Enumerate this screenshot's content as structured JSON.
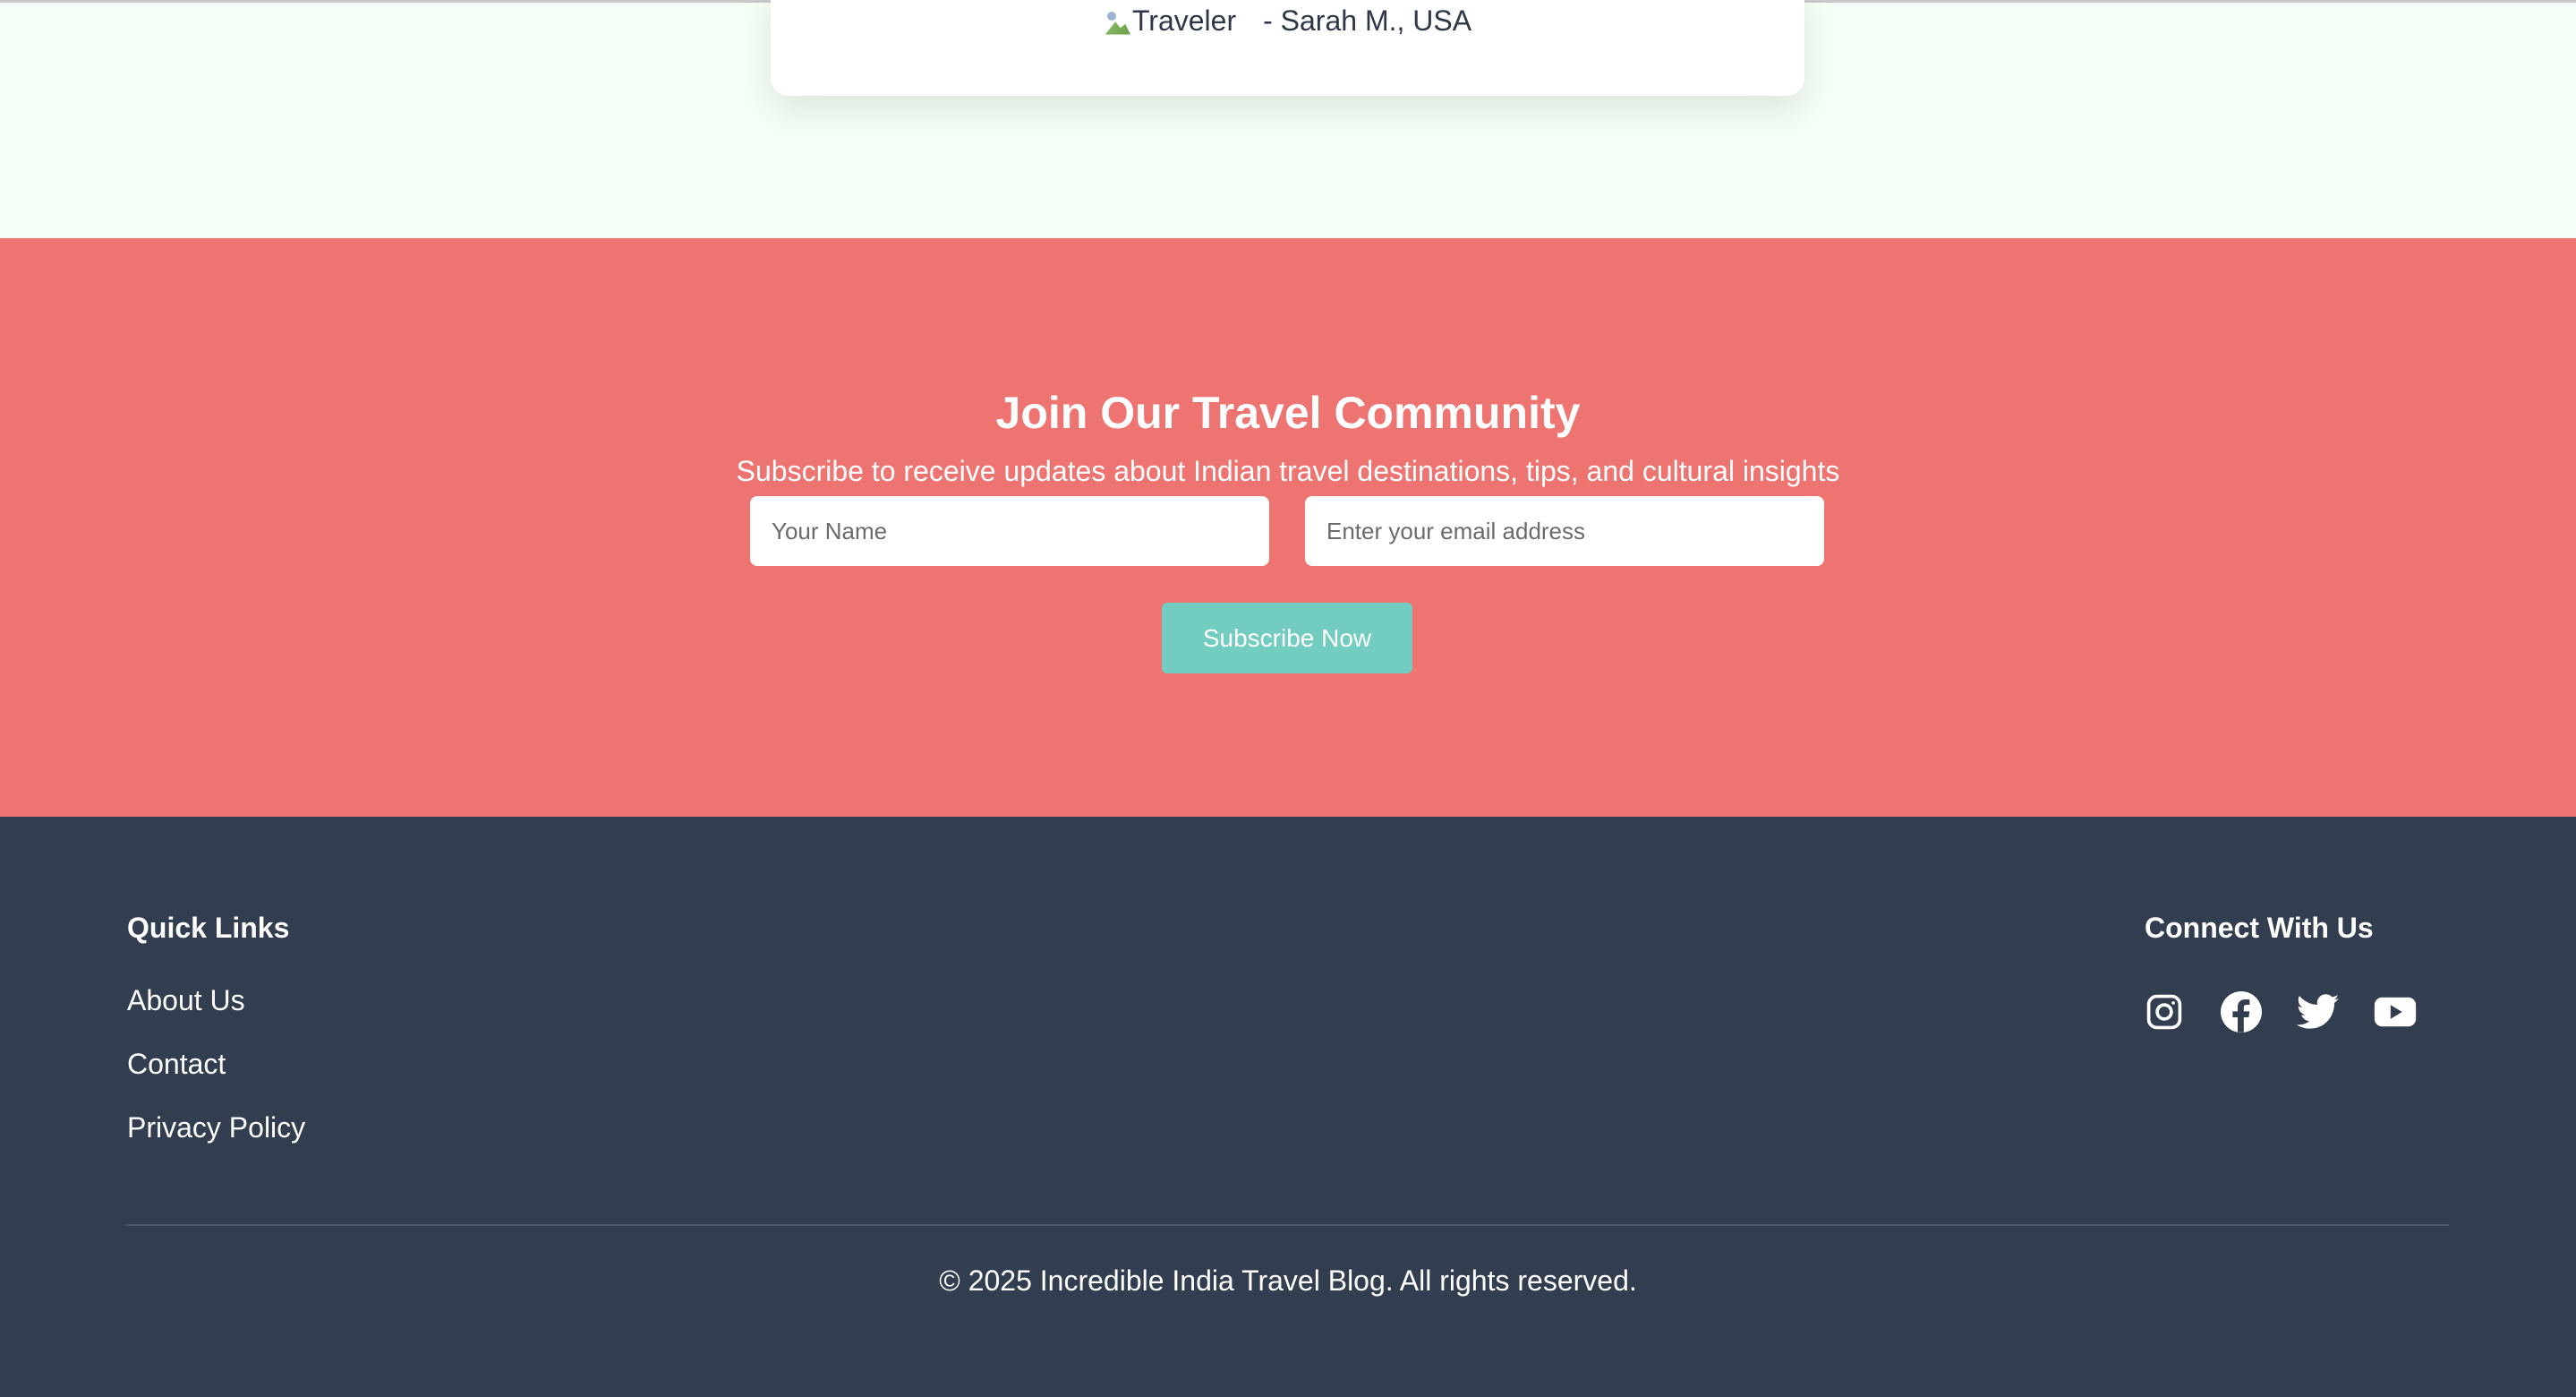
{
  "testimonial": {
    "image_alt": "Traveler",
    "author": "- Sarah M., USA"
  },
  "subscribe": {
    "title": "Join Our Travel Community",
    "subtitle": "Subscribe to receive updates about Indian travel destinations, tips, and cultural insights",
    "name_placeholder": "Your Name",
    "email_placeholder": "Enter your email address",
    "button_label": "Subscribe Now"
  },
  "footer": {
    "quick_links_title": "Quick Links",
    "quick_links": [
      {
        "label": "About Us"
      },
      {
        "label": "Contact"
      },
      {
        "label": "Privacy Policy"
      }
    ],
    "connect_title": "Connect With Us",
    "social": [
      {
        "icon": "instagram-icon"
      },
      {
        "icon": "facebook-icon"
      },
      {
        "icon": "twitter-icon"
      },
      {
        "icon": "youtube-icon"
      }
    ],
    "copyright": "© 2025 Incredible India Travel Blog. All rights reserved."
  },
  "colors": {
    "page_bg": "#f5fff5",
    "subscribe_bg": "#ee7471",
    "button_bg": "#72ccbf",
    "footer_bg": "#323d4f"
  }
}
